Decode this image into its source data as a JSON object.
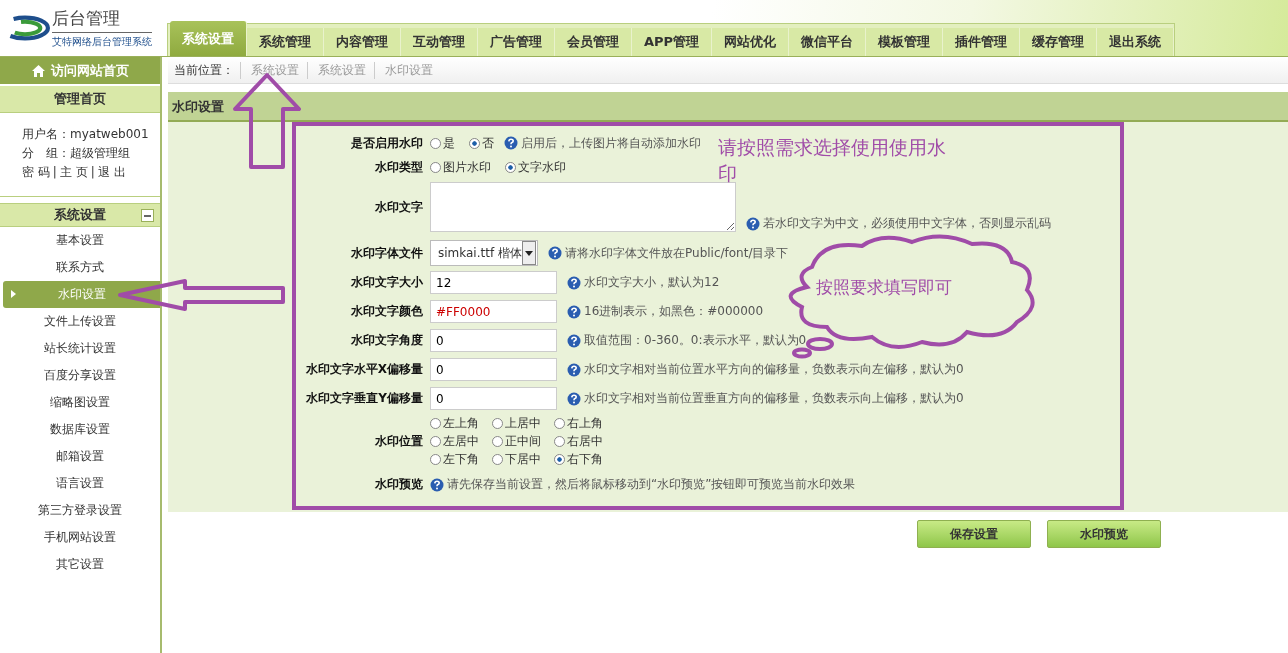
{
  "logo": {
    "title": "后台管理",
    "subtitle": "艾特网络后台管理系统"
  },
  "tabs": [
    {
      "label": "系统设置",
      "selected": true
    },
    {
      "label": "系统管理",
      "selected": false
    },
    {
      "label": "内容管理",
      "selected": false
    },
    {
      "label": "互动管理",
      "selected": false
    },
    {
      "label": "广告管理",
      "selected": false
    },
    {
      "label": "会员管理",
      "selected": false
    },
    {
      "label": "APP管理",
      "selected": false
    },
    {
      "label": "网站优化",
      "selected": false
    },
    {
      "label": "微信平台",
      "selected": false
    },
    {
      "label": "模板管理",
      "selected": false
    },
    {
      "label": "插件管理",
      "selected": false
    },
    {
      "label": "缓存管理",
      "selected": false
    },
    {
      "label": "退出系统",
      "selected": false
    }
  ],
  "sidebar": {
    "home_link": "访问网站首页",
    "admin_title": "管理首页",
    "user": [
      {
        "label": "用户名：",
        "value": "myatweb001"
      },
      {
        "label": "分　组：",
        "value": "超级管理组"
      }
    ],
    "links": [
      "密 码",
      "主 页",
      "退 出"
    ],
    "link_separator": "|",
    "section": {
      "title": "系统设置",
      "expanded": true
    },
    "items": [
      {
        "label": "基本设置",
        "selected": false
      },
      {
        "label": "联系方式",
        "selected": false
      },
      {
        "label": "水印设置",
        "selected": true
      },
      {
        "label": "文件上传设置",
        "selected": false
      },
      {
        "label": "站长统计设置",
        "selected": false
      },
      {
        "label": "百度分享设置",
        "selected": false
      },
      {
        "label": "缩略图设置",
        "selected": false
      },
      {
        "label": "数据库设置",
        "selected": false
      },
      {
        "label": "邮箱设置",
        "selected": false
      },
      {
        "label": "语言设置",
        "selected": false
      },
      {
        "label": "第三方登录设置",
        "selected": false
      },
      {
        "label": "手机网站设置",
        "selected": false
      },
      {
        "label": "其它设置",
        "selected": false
      }
    ]
  },
  "breadcrumb": {
    "label": "当前位置：",
    "items": [
      "系统设置",
      "系统设置",
      "水印设置"
    ]
  },
  "panel_title": "水印设置",
  "form": [
    {
      "kind": "radio",
      "label": "是否启用水印",
      "options": [
        {
          "label": "是",
          "selected": false
        },
        {
          "label": "否",
          "selected": true
        }
      ],
      "hint": "启用后，上传图片将自动添加水印"
    },
    {
      "kind": "radio",
      "label": "水印类型",
      "options": [
        {
          "label": "图片水印",
          "selected": false
        },
        {
          "label": "文字水印",
          "selected": true
        }
      ]
    },
    {
      "kind": "textarea",
      "label": "水印文字",
      "hint": "若水印文字为中文，必须使用中文字体，否则显示乱码"
    },
    {
      "kind": "select",
      "label": "水印字体文件",
      "value": "simkai.ttf 楷体",
      "hint": "请将水印字体文件放在Public/font/目录下"
    },
    {
      "kind": "text",
      "label": "水印文字大小",
      "value": "12",
      "hint": "水印文字大小，默认为12"
    },
    {
      "kind": "text",
      "label": "水印文字颜色",
      "value": "#FF0000",
      "color": "#cc0000",
      "hint": "16进制表示，如黑色：#000000"
    },
    {
      "kind": "text",
      "label": "水印文字角度",
      "value": "0",
      "hint": "取值范围：0-360。0:表示水平，默认为0"
    },
    {
      "kind": "text",
      "label": "水印文字水平X偏移量",
      "value": "0",
      "hint": "水印文字相对当前位置水平方向的偏移量，负数表示向左偏移，默认为0"
    },
    {
      "kind": "text",
      "label": "水印文字垂直Y偏移量",
      "value": "0",
      "hint": "水印文字相对当前位置垂直方向的偏移量，负数表示向上偏移，默认为0"
    },
    {
      "kind": "grid",
      "label": "水印位置",
      "options": [
        {
          "label": "左上角",
          "selected": false
        },
        {
          "label": "上居中",
          "selected": false
        },
        {
          "label": "右上角",
          "selected": false
        },
        {
          "label": "左居中",
          "selected": false
        },
        {
          "label": "正中间",
          "selected": false
        },
        {
          "label": "右居中",
          "selected": false
        },
        {
          "label": "左下角",
          "selected": false
        },
        {
          "label": "下居中",
          "selected": false
        },
        {
          "label": "右下角",
          "selected": true
        }
      ]
    },
    {
      "kind": "info",
      "label": "水印预览",
      "hint": "请先保存当前设置，然后将鼠标移动到“水印预览”按钮即可预览当前水印效果"
    }
  ],
  "buttons": [
    "保存设置",
    "水印预览"
  ],
  "annotations": [
    {
      "kind": "frame"
    },
    {
      "kind": "arrow-up"
    },
    {
      "kind": "arrow-left"
    },
    {
      "kind": "note",
      "text": "请按照需求选择使用使用水印"
    },
    {
      "kind": "cloud",
      "text": "按照要求填写即可"
    }
  ]
}
